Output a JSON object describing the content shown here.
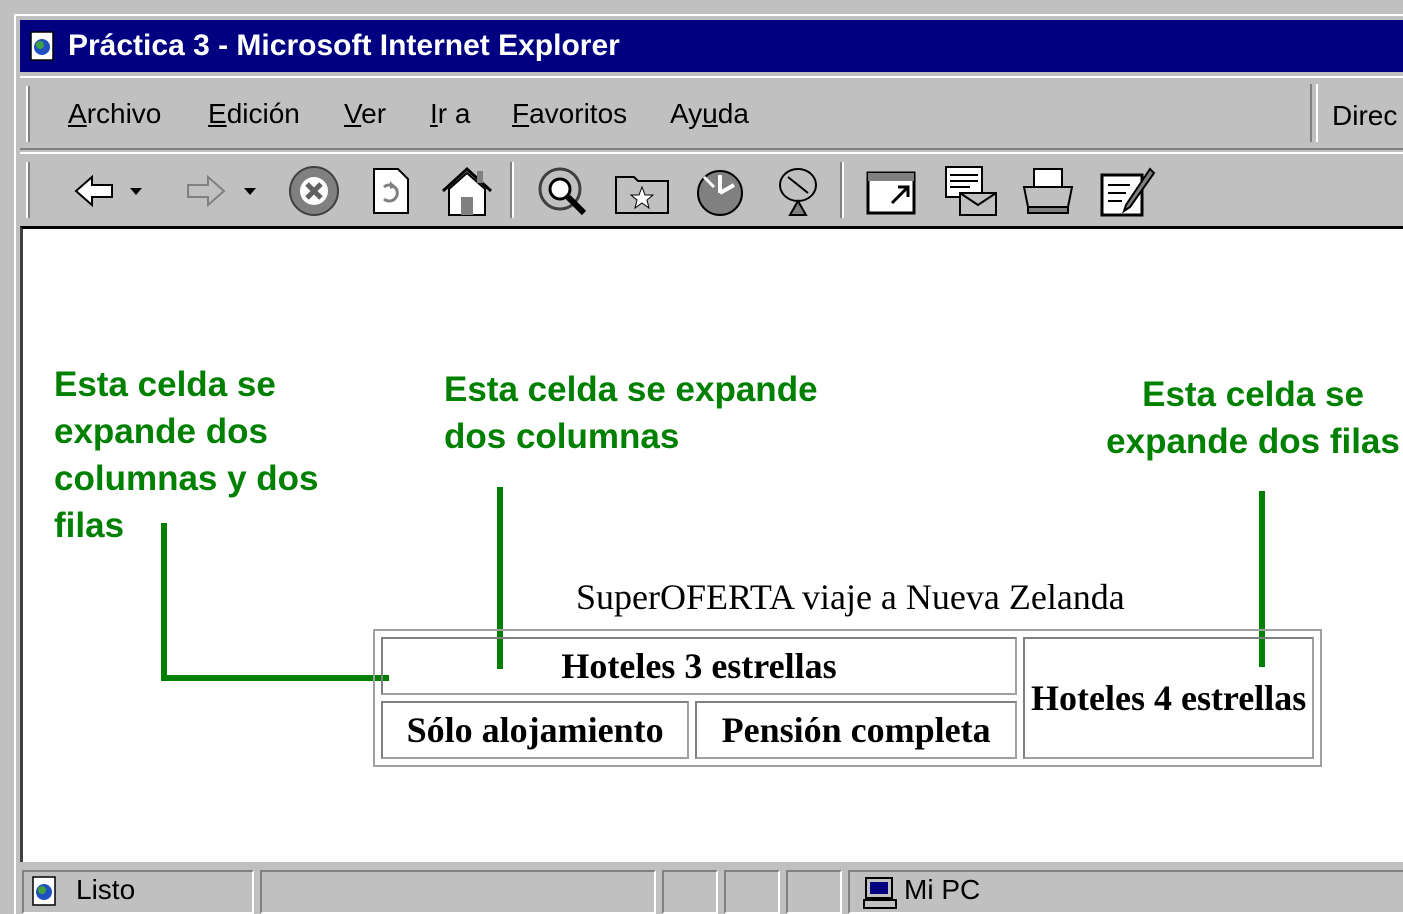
{
  "window": {
    "title": "Práctica 3 - Microsoft Internet Explorer"
  },
  "menu": {
    "items": [
      {
        "pre": "",
        "u": "A",
        "post": "rchivo"
      },
      {
        "pre": "",
        "u": "E",
        "post": "dición"
      },
      {
        "pre": "",
        "u": "V",
        "post": "er"
      },
      {
        "pre": "",
        "u": "I",
        "post": "r a"
      },
      {
        "pre": "",
        "u": "F",
        "post": "avoritos"
      },
      {
        "pre": "Ay",
        "u": "u",
        "post": "da"
      }
    ],
    "address_label": "Direc"
  },
  "toolbar": {
    "icons": [
      "back-icon",
      "forward-icon",
      "stop-icon",
      "refresh-icon",
      "home-icon",
      "search-icon",
      "favorites-icon",
      "history-icon",
      "channels-icon",
      "fullscreen-icon",
      "mail-icon",
      "print-icon",
      "edit-icon"
    ]
  },
  "page": {
    "annotation_left": [
      "Esta celda se",
      "expande dos",
      "columnas y dos",
      "filas"
    ],
    "annotation_middle": [
      "Esta celda se expande",
      "dos columnas"
    ],
    "annotation_right": [
      "Esta celda se",
      "expande dos filas"
    ],
    "caption": "SuperOFERTA viaje a Nueva Zelanda",
    "table": {
      "header_colspan": "Hoteles 3 estrellas",
      "header_rowspan": "Hoteles 4 estrellas",
      "sub1": "Sólo alojamiento",
      "sub2": "Pensión completa"
    },
    "annotation_color": "#008000"
  },
  "status": {
    "text": "Listo",
    "zone": "Mi PC"
  }
}
